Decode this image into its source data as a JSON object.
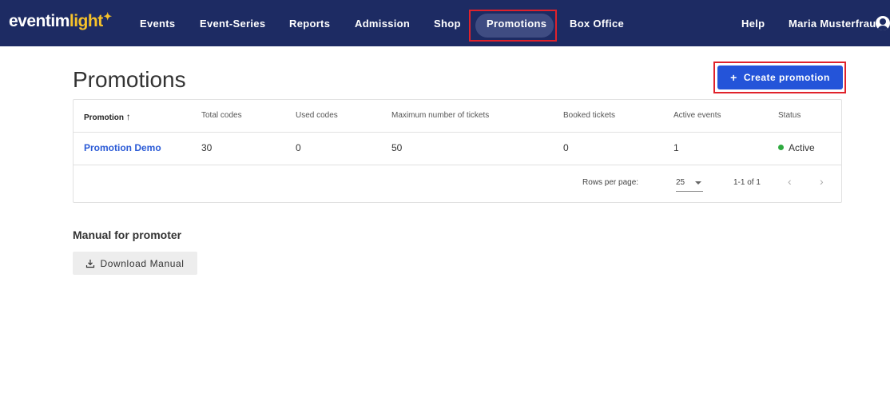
{
  "brand": {
    "name_dark": "eventim",
    "name_light": "light"
  },
  "nav": {
    "items": [
      "Events",
      "Event-Series",
      "Reports",
      "Admission",
      "Shop",
      "Promotions",
      "Box Office"
    ],
    "active": "Promotions",
    "help": "Help",
    "user": "Maria Musterfrau"
  },
  "page": {
    "title": "Promotions",
    "create_button": "Create promotion"
  },
  "table": {
    "columns": [
      "Promotion",
      "Total codes",
      "Used codes",
      "Maximum number of tickets",
      "Booked tickets",
      "Active events",
      "Status"
    ],
    "sort_indicator": "↑",
    "rows": [
      {
        "promotion": "Promotion Demo",
        "total_codes": "30",
        "used_codes": "0",
        "max_tickets": "50",
        "booked_tickets": "0",
        "active_events": "1",
        "status": "Active"
      }
    ],
    "footer": {
      "rows_per_page_label": "Rows per page:",
      "rows_per_page_value": "25",
      "range": "1-1 of 1"
    }
  },
  "manual": {
    "title": "Manual for promoter",
    "download_button": "Download Manual"
  },
  "colors": {
    "nav_bg": "#1d2b63",
    "accent": "#2454d9",
    "brand_yellow": "#f6c22a",
    "status_active": "#2eaa3f",
    "highlight": "#e0222b"
  }
}
